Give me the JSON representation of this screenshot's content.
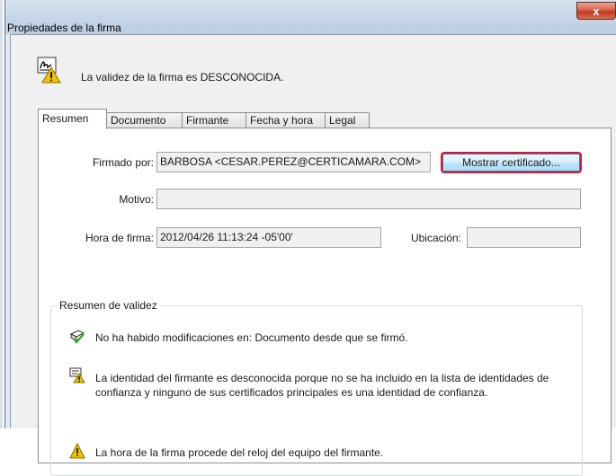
{
  "window": {
    "title": "Propiedades de la firma",
    "close_glyph": "x"
  },
  "header": {
    "status": "La validez de la firma es DESCONOCIDA.",
    "icon": "signature-unknown-icon"
  },
  "tabs": [
    {
      "label": "Resumen",
      "active": true
    },
    {
      "label": "Documento",
      "active": false
    },
    {
      "label": "Firmante",
      "active": false
    },
    {
      "label": "Fecha y hora",
      "active": false
    },
    {
      "label": "Legal",
      "active": false
    }
  ],
  "summary": {
    "signed_by_label": "Firmado por:",
    "signed_by_value": "BARBOSA <CESAR.PEREZ@CERTICAMARA.COM>",
    "show_certificate": "Mostrar certificado...",
    "reason_label": "Motivo:",
    "reason_value": "",
    "sign_time_label": "Hora de firma:",
    "sign_time_value": "2012/04/26 11:13:24 -05'00'",
    "location_label": "Ubicación:",
    "location_value": ""
  },
  "validity": {
    "title": "Resumen de validez",
    "items": [
      {
        "icon": "doc-valid-icon",
        "text": "No ha habido modificaciones en: Documento desde que se firmó."
      },
      {
        "icon": "identity-warning-icon",
        "text": "La identidad del firmante es desconocida porque no se ha incluido en la lista de identidades de confianza y ninguno de sus certificados principales es una identidad de confianza."
      },
      {
        "icon": "warning-icon",
        "text": "La hora de la firma procede del reloj del equipo del firmante."
      }
    ]
  },
  "colors": {
    "highlight": "#e0142a",
    "warning": "#f2c200",
    "valid": "#3aa53a"
  }
}
